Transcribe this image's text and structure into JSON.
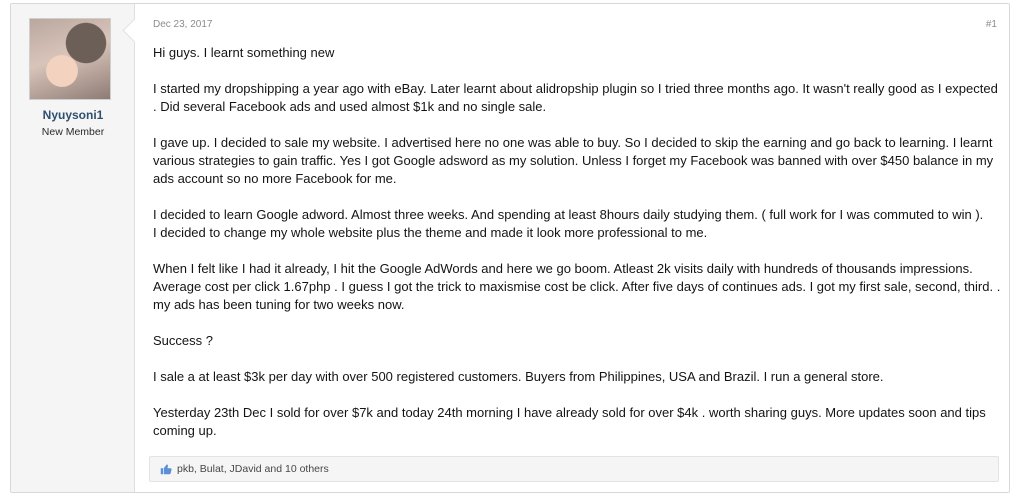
{
  "user": {
    "name": "Nyuysoni1",
    "title": "New Member"
  },
  "post": {
    "date": "Dec 23, 2017",
    "number": "#1",
    "paragraphs": [
      "Hi guys. I learnt something new",
      "I started my dropshipping a year ago with eBay. Later learnt about alidropship plugin so I tried three months ago. It wasn't really good as I expected . Did several Facebook ads and used almost $1k and no single sale.",
      "I gave up. I decided to sale my website. I advertised here no one was able to buy. So I decided to skip the earning and go back to learning. I learnt various strategies to gain traffic. Yes I got Google adsword as my solution. Unless I forget my Facebook was banned with over $450 balance in my ads account so no more Facebook for me.",
      "I decided to learn Google adword. Almost three weeks. And spending at least 8hours daily studying them. ( full work for I was commuted to win ).",
      "I decided to change my whole website plus the theme and made it look more professional to me.",
      "When I felt like I had it already, I hit the Google AdWords and here we go boom. Atleast 2k visits daily with hundreds of thousands impressions. Average cost per click 1.67php . I guess I got the trick to maxismise cost be click. After five days of continues ads. I got my first sale, second, third. . my ads has been tuning for two weeks now.",
      "Success ?",
      "I sale a at least $3k per day with over 500 registered customers. Buyers from Philippines, USA and Brazil. I run a general store.",
      "Yesterday 23th Dec I sold for over $7k and today 24th morning I have already sold for over $4k . worth sharing guys. More updates soon and tips coming up."
    ]
  },
  "likes": {
    "text": "pkb, Bulat, JDavid and 10 others",
    "icon": "thumbs-up-icon",
    "icon_color": "#5b8fd6"
  }
}
